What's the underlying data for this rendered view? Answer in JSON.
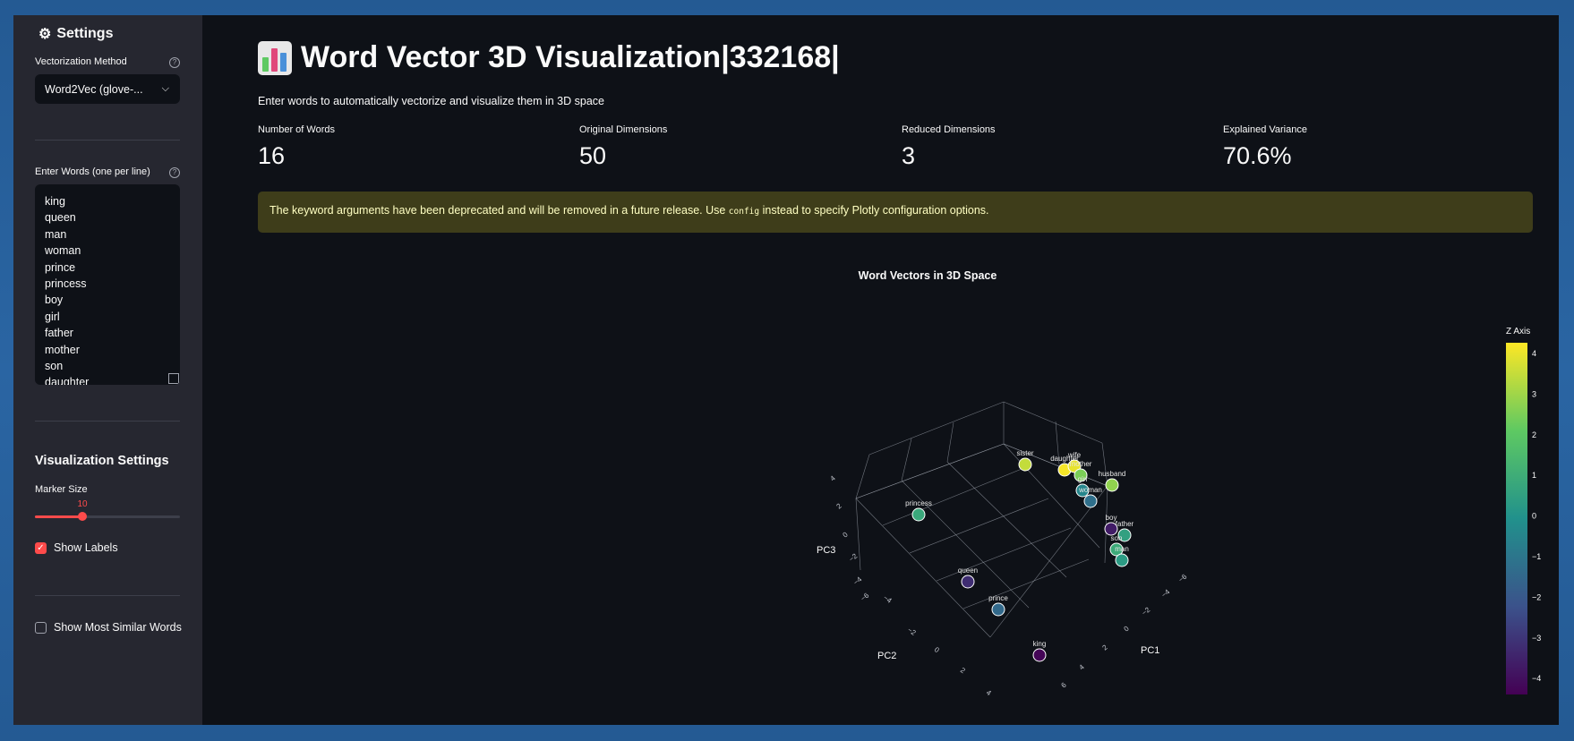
{
  "sidebar": {
    "title": "Settings",
    "method_label": "Vectorization Method",
    "method_value": "Word2Vec (glove-...",
    "words_label": "Enter Words (one per line)",
    "words": [
      "king",
      "queen",
      "man",
      "woman",
      "prince",
      "princess",
      "boy",
      "girl",
      "father",
      "mother",
      "son",
      "daughter"
    ],
    "viz_heading": "Visualization Settings",
    "marker_label": "Marker Size",
    "marker_value": "10",
    "marker_fraction": 0.33,
    "show_labels": "Show Labels",
    "show_labels_checked": true,
    "similar": "Show Most Similar Words",
    "similar_checked": false
  },
  "main": {
    "title": "Word Vector 3D Visualization|332168|",
    "subtitle": "Enter words to automatically vectorize and visualize them in 3D space",
    "metrics": [
      {
        "label": "Number of Words",
        "value": "16"
      },
      {
        "label": "Original Dimensions",
        "value": "50"
      },
      {
        "label": "Reduced Dimensions",
        "value": "3"
      },
      {
        "label": "Explained Variance",
        "value": "70.6%"
      }
    ],
    "warning_pre": "The keyword arguments have been deprecated and will be removed in a future release. Use ",
    "warning_code": "config",
    "warning_post": " instead to specify Plotly configuration options."
  },
  "chart_data": {
    "type": "scatter",
    "title": "Word Vectors in 3D Space",
    "axes": {
      "x": "PC1",
      "y": "PC2",
      "z": "PC3"
    },
    "colorbar_title": "Z Axis",
    "colorbar_ticks": [
      "4",
      "3",
      "2",
      "1",
      "0",
      "−1",
      "−2",
      "−3",
      "−4"
    ],
    "z_range": [
      -4.5,
      4.3
    ],
    "colorscale": [
      "#440154",
      "#3b528b",
      "#21918c",
      "#5ec962",
      "#fde725"
    ],
    "points": [
      {
        "label": "sister",
        "z": 3.5
      },
      {
        "label": "daughter",
        "z": 4.2
      },
      {
        "label": "wife",
        "z": 4.0
      },
      {
        "label": "mother",
        "z": 2.5
      },
      {
        "label": "husband",
        "z": 2.8
      },
      {
        "label": "girl",
        "z": -0.5
      },
      {
        "label": "woman",
        "z": -1.3
      },
      {
        "label": "princess",
        "z": 0.8
      },
      {
        "label": "boy",
        "z": -3.8
      },
      {
        "label": "father",
        "z": 0.5
      },
      {
        "label": "son",
        "z": 0.9
      },
      {
        "label": "man",
        "z": 0.3
      },
      {
        "label": "queen",
        "z": -3.3
      },
      {
        "label": "prince",
        "z": -1.5
      },
      {
        "label": "king",
        "z": -4.4
      }
    ],
    "pc1_ticks": [
      "−6",
      "−4",
      "−2",
      "0",
      "2",
      "4",
      "6"
    ],
    "pc2_ticks": [
      "−6",
      "−4",
      "−2",
      "0",
      "2",
      "4"
    ],
    "pc3_ticks": [
      "4",
      "2",
      "0",
      "−2",
      "−4",
      "−6"
    ]
  }
}
